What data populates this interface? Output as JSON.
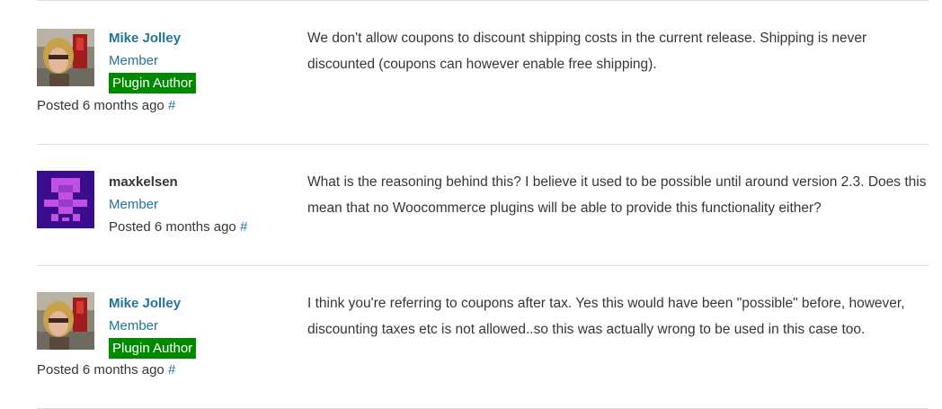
{
  "replies": [
    {
      "author": "Mike Jolley",
      "role": "Member",
      "badge": "Plugin Author",
      "posted": "Posted 6 months ago",
      "permalink": "#",
      "text": "We don't allow coupons to discount shipping costs in the current release. Shipping is never discounted (coupons can however enable free shipping)."
    },
    {
      "author": "maxkelsen",
      "role": "Member",
      "posted": "Posted 6 months ago",
      "permalink": "#",
      "text": "What is the reasoning behind this? I believe it used to be possible until around version 2.3. Does this mean that no Woocommerce plugins will be able to provide this functionality either?"
    },
    {
      "author": "Mike Jolley",
      "role": "Member",
      "badge": "Plugin Author",
      "posted": "Posted 6 months ago",
      "permalink": "#",
      "text": "I think you're referring to coupons after tax. Yes this would have been \"possible\" before, however, discounting taxes etc is not allowed..so this was actually wrong to be used in this case too."
    }
  ],
  "colors": {
    "link": "#21759b",
    "badge_bg": "#008a00",
    "text": "#32373c",
    "divider": "#dddddd",
    "identicon_bg": "#3a0d8c",
    "identicon_fg": "#c050e8"
  }
}
